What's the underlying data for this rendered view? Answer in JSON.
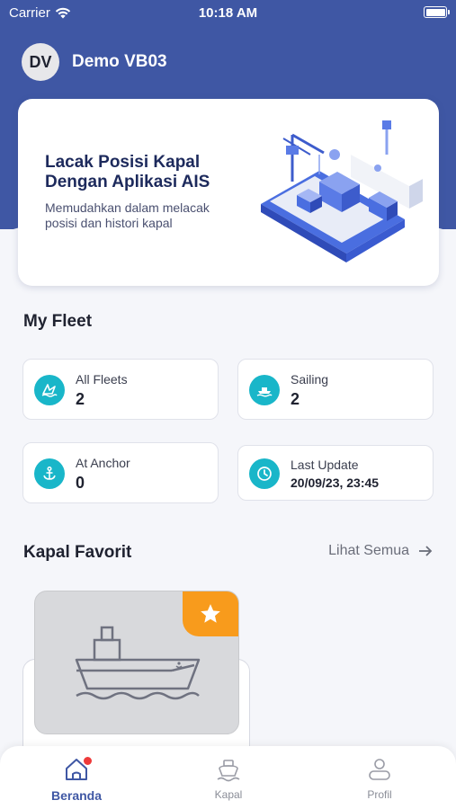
{
  "status_bar": {
    "carrier": "Carrier",
    "time": "10:18 AM"
  },
  "user": {
    "initials": "DV",
    "name": "Demo VB03"
  },
  "banner": {
    "title": "Lacak Posisi Kapal Dengan Aplikasi AIS",
    "subtitle": "Memudahkan dalam melacak posisi dan histori kapal"
  },
  "fleet": {
    "title": "My Fleet",
    "cards": [
      {
        "label": "All Fleets",
        "value": "2",
        "icon": "fleet-icon"
      },
      {
        "label": "Sailing",
        "value": "2",
        "icon": "sailing-ship-icon"
      },
      {
        "label": "At Anchor",
        "value": "0",
        "icon": "anchor-icon"
      },
      {
        "label": "Last Update",
        "value": "20/09/23, 23:45",
        "icon": "clock-icon"
      }
    ]
  },
  "favorites": {
    "title": "Kapal Favorit",
    "see_all": "Lihat Semua"
  },
  "tabs": [
    {
      "label": "Beranda",
      "icon": "home-icon",
      "active": true
    },
    {
      "label": "Kapal",
      "icon": "ship-icon",
      "active": false
    },
    {
      "label": "Profil",
      "icon": "profile-icon",
      "active": false
    }
  ],
  "colors": {
    "primary": "#3f57a4",
    "accent": "#19b6c9",
    "star": "#f89b1c",
    "badge": "#ee3a3a"
  }
}
